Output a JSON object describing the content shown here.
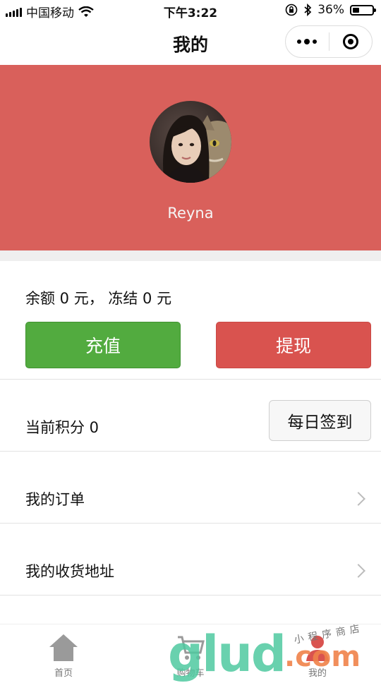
{
  "status_bar": {
    "carrier": "中国移动",
    "time": "下午3:22",
    "battery_percent": "36%",
    "battery_level": 0.36,
    "icons": [
      "signal-icon",
      "wifi-icon",
      "orientation-lock-icon",
      "bluetooth-icon",
      "battery-icon"
    ]
  },
  "nav": {
    "title": "我的",
    "capsule_icons": [
      "more-icon",
      "close-target-icon"
    ]
  },
  "profile": {
    "username": "Reyna",
    "background_color": "#d9605b"
  },
  "wallet": {
    "balance_text": "余额 0 元， 冻结 0 元",
    "recharge_label": "充值",
    "withdraw_label": "提现",
    "recharge_color": "#52ab3f",
    "withdraw_color": "#d9534f"
  },
  "points": {
    "text": "当前积分 0",
    "checkin_label": "每日签到"
  },
  "menu": [
    {
      "label": "我的订单"
    },
    {
      "label": "我的收货地址"
    }
  ],
  "tabbar": {
    "tabs": [
      {
        "label": "首页",
        "icon": "home-icon"
      },
      {
        "label": "购物车",
        "icon": "cart-icon"
      },
      {
        "label": "我的",
        "icon": "profile-icon"
      }
    ]
  },
  "watermark": {
    "brand": "glud",
    "tld": ".com",
    "tagline": "小程序商店"
  }
}
